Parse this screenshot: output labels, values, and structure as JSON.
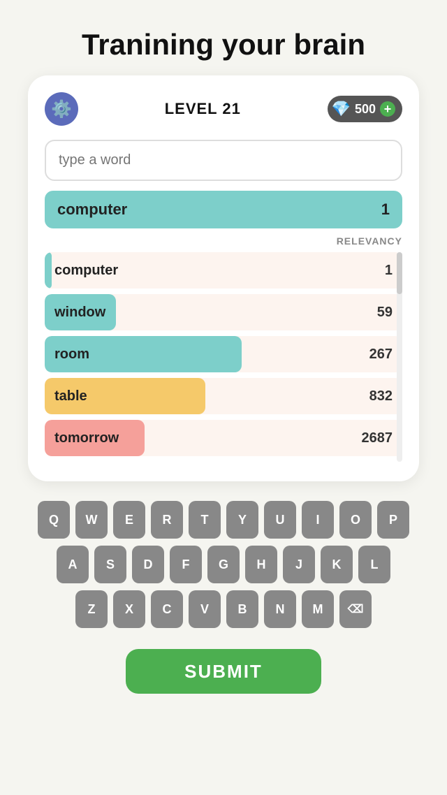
{
  "header": {
    "title": "Tranining your brain"
  },
  "game": {
    "level_label": "LEVEL 21",
    "gems_count": "500",
    "input_placeholder": "type a word",
    "relevancy_label": "RELEVANCY",
    "current_word": {
      "text": "computer",
      "rank": "1"
    },
    "words": [
      {
        "word": "computer",
        "rank": "1",
        "bar_pct": 2,
        "bar_color": "#7dcfca"
      },
      {
        "word": "window",
        "rank": "59",
        "bar_pct": 20,
        "bar_color": "#7dcfca"
      },
      {
        "word": "room",
        "rank": "267",
        "bar_pct": 55,
        "bar_color": "#7dcfca"
      },
      {
        "word": "table",
        "rank": "832",
        "bar_pct": 45,
        "bar_color": "#f5c96a"
      },
      {
        "word": "tomorrow",
        "rank": "2687",
        "bar_pct": 28,
        "bar_color": "#f5a09a"
      }
    ]
  },
  "keyboard": {
    "rows": [
      [
        "Q",
        "W",
        "E",
        "R",
        "T",
        "Y",
        "U",
        "I",
        "O",
        "P"
      ],
      [
        "A",
        "S",
        "D",
        "F",
        "G",
        "H",
        "J",
        "K",
        "L"
      ],
      [
        "Z",
        "X",
        "C",
        "V",
        "B",
        "N",
        "M",
        "⌫"
      ]
    ]
  },
  "submit_label": "SUBMIT"
}
